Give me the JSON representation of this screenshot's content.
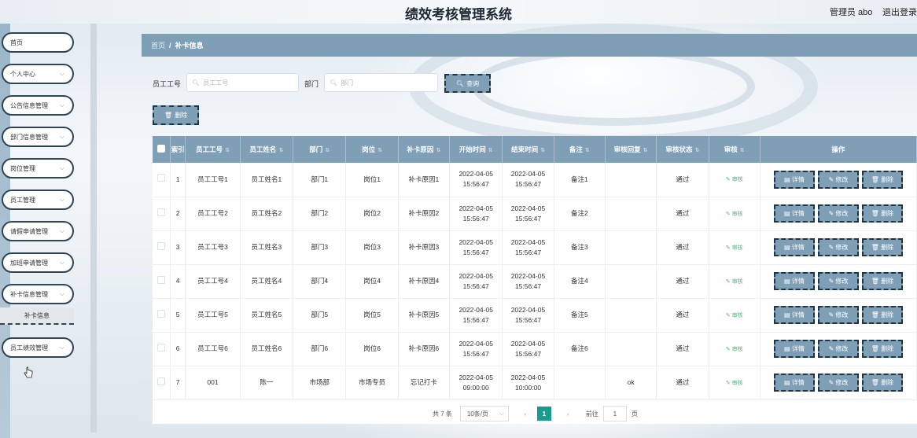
{
  "app": {
    "title": "绩效考核管理系统",
    "admin_label": "管理员 abo",
    "logout": "退出登录"
  },
  "sidebar": {
    "items": [
      {
        "label": "首页"
      },
      {
        "label": "个人中心"
      },
      {
        "label": "公告信息管理"
      },
      {
        "label": "部门信息管理"
      },
      {
        "label": "岗位管理"
      },
      {
        "label": "员工管理"
      },
      {
        "label": "请假申请管理"
      },
      {
        "label": "加班申请管理"
      },
      {
        "label": "补卡信息管理"
      },
      {
        "label": "员工绩效管理"
      }
    ],
    "submenu_active": "补卡信息"
  },
  "breadcrumb": {
    "home": "首页",
    "separator": "/",
    "current": "补卡信息"
  },
  "search": {
    "emp_no_label": "员工工号",
    "emp_no_placeholder": "员工工号",
    "dept_label": "部门",
    "dept_placeholder": "部门",
    "query_button": "查询"
  },
  "toolbar": {
    "delete_button": "删除"
  },
  "table": {
    "headers": [
      "索引",
      "员工工号",
      "员工姓名",
      "部门",
      "岗位",
      "补卡原因",
      "开始时间",
      "结束时间",
      "备注",
      "审核回复",
      "审核状态",
      "审核",
      "操作"
    ],
    "audit_link": "审核",
    "op_detail": "详情",
    "op_edit": "修改",
    "op_delete": "删除",
    "rows": [
      {
        "index": "1",
        "emp_no": "员工工号1",
        "name": "员工姓名1",
        "dept": "部门1",
        "post": "岗位1",
        "reason": "补卡原因1",
        "start_date": "2022-04-05",
        "start_time": "15:56:47",
        "end_date": "2022-04-05",
        "end_time": "15:56:47",
        "note": "备注1",
        "reply": "",
        "status": "通过"
      },
      {
        "index": "2",
        "emp_no": "员工工号2",
        "name": "员工姓名2",
        "dept": "部门2",
        "post": "岗位2",
        "reason": "补卡原因2",
        "start_date": "2022-04-05",
        "start_time": "15:56:47",
        "end_date": "2022-04-05",
        "end_time": "15:56:47",
        "note": "备注2",
        "reply": "",
        "status": "通过"
      },
      {
        "index": "3",
        "emp_no": "员工工号3",
        "name": "员工姓名3",
        "dept": "部门3",
        "post": "岗位3",
        "reason": "补卡原因3",
        "start_date": "2022-04-05",
        "start_time": "15:56:47",
        "end_date": "2022-04-05",
        "end_time": "15:56:47",
        "note": "备注3",
        "reply": "",
        "status": "通过"
      },
      {
        "index": "4",
        "emp_no": "员工工号4",
        "name": "员工姓名4",
        "dept": "部门4",
        "post": "岗位4",
        "reason": "补卡原因4",
        "start_date": "2022-04-05",
        "start_time": "15:56:47",
        "end_date": "2022-04-05",
        "end_time": "15:56:47",
        "note": "备注4",
        "reply": "",
        "status": "通过"
      },
      {
        "index": "5",
        "emp_no": "员工工号5",
        "name": "员工姓名5",
        "dept": "部门5",
        "post": "岗位5",
        "reason": "补卡原因5",
        "start_date": "2022-04-05",
        "start_time": "15:56:47",
        "end_date": "2022-04-05",
        "end_time": "15:56:47",
        "note": "备注5",
        "reply": "",
        "status": "通过"
      },
      {
        "index": "6",
        "emp_no": "员工工号6",
        "name": "员工姓名6",
        "dept": "部门6",
        "post": "岗位6",
        "reason": "补卡原因6",
        "start_date": "2022-04-05",
        "start_time": "15:56:47",
        "end_date": "2022-04-05",
        "end_time": "15:56:47",
        "note": "备注6",
        "reply": "",
        "status": "通过"
      },
      {
        "index": "7",
        "emp_no": "001",
        "name": "陈一",
        "dept": "市场部",
        "post": "市场专员",
        "reason": "忘记打卡",
        "start_date": "2022-04-05",
        "start_time": "09:00:00",
        "end_date": "2022-04-05",
        "end_time": "10:00:00",
        "note": "",
        "reply": "ok",
        "status": "通过"
      }
    ]
  },
  "pagination": {
    "total_text": "共 7 条",
    "page_size": "10条/页",
    "prev": "‹",
    "current_page": "1",
    "next": "›",
    "goto_label": "前往",
    "goto_value": "1",
    "page_suffix": "页"
  },
  "colors": {
    "accent": "#7f9fb6",
    "dashed_border": "#1f3443",
    "page_active": "#1a9b8f",
    "audit_green": "#58b37a"
  }
}
